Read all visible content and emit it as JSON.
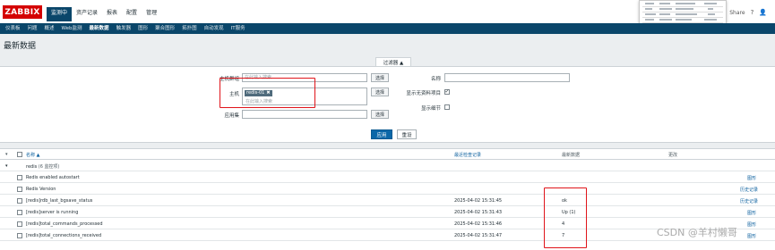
{
  "header": {
    "logo": "ZABBIX",
    "nav": [
      {
        "label": "监测中",
        "active": true
      },
      {
        "label": "资产记录",
        "active": false
      },
      {
        "label": "报表",
        "active": false
      },
      {
        "label": "配置",
        "active": false
      },
      {
        "label": "管理",
        "active": false
      }
    ],
    "share_label": "Share",
    "help_glyph": "?",
    "user_glyph": "👤"
  },
  "subnav": [
    {
      "label": "仪表板",
      "active": false
    },
    {
      "label": "问题",
      "active": false
    },
    {
      "label": "概述",
      "active": false
    },
    {
      "label": "Web监测",
      "active": false
    },
    {
      "label": "最新数据",
      "active": true
    },
    {
      "label": "触发器",
      "active": false
    },
    {
      "label": "图形",
      "active": false
    },
    {
      "label": "聚合图形",
      "active": false
    },
    {
      "label": "拓扑图",
      "active": false
    },
    {
      "label": "自动发现",
      "active": false
    },
    {
      "label": "IT服务",
      "active": false
    }
  ],
  "page_title": "最新数据",
  "filter": {
    "tab_label": "过滤器 ▲",
    "host_group_label": "主机群组",
    "host_group_placeholder": "在此输入搜索",
    "host_label": "主机",
    "host_chip": "redis-01",
    "host_chip_remove": "✖",
    "host_placeholder": "在此输入搜索",
    "app_label": "应用集",
    "name_label": "名称",
    "show_no_data_label": "显示无资料项目",
    "show_details_label": "显示细节",
    "select_label": "选择",
    "apply_label": "应用",
    "reset_label": "重设"
  },
  "table": {
    "headers": {
      "name": "名称 ▲",
      "last_check": "最近检查记录",
      "last_value": "最新数据",
      "change": "更改"
    },
    "group": {
      "name": "redis",
      "count": "(6 监控项)"
    },
    "rows": [
      {
        "name": "Redis enabled autostart",
        "time": "",
        "value": "",
        "action": "图形"
      },
      {
        "name": "Redis Version",
        "time": "",
        "value": "",
        "action": "历史记录"
      },
      {
        "name": "[redis]rdb_last_bgsave_status",
        "time": "2025-04-02 15:31:45",
        "value": "ok",
        "action": "历史记录"
      },
      {
        "name": "[redis]server is running",
        "time": "2025-04-02 15:31:43",
        "value": "Up (1)",
        "action": "图形"
      },
      {
        "name": "[redis]total_commands_processed",
        "time": "2025-04-02 15:31:46",
        "value": "4",
        "action": "图形"
      },
      {
        "name": "[redis]total_connections_received",
        "time": "2025-04-02 15:31:47",
        "value": "7",
        "action": "图形"
      }
    ]
  },
  "watermark": "CSDN @羊村懒哥"
}
